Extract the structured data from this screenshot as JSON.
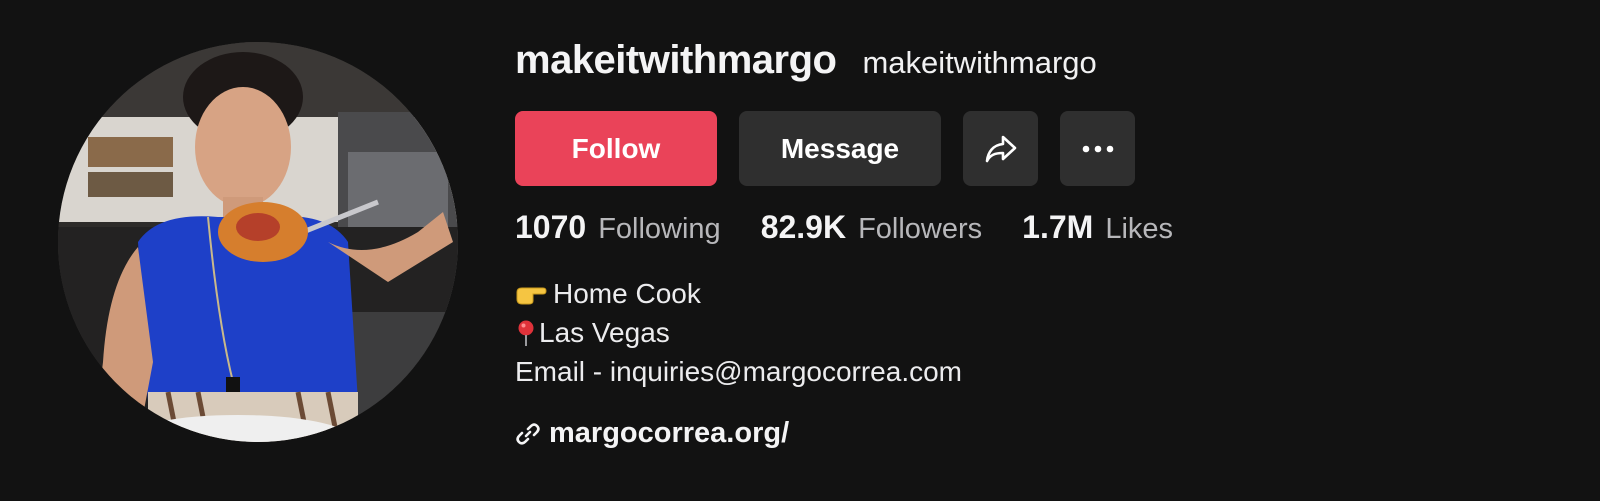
{
  "profile": {
    "username": "makeitwithmargo",
    "nickname": "makeitwithmargo"
  },
  "actions": {
    "follow_label": "Follow",
    "message_label": "Message",
    "share_icon": "share-arrow-icon",
    "more_icon": "more-dots-icon"
  },
  "stats": [
    {
      "value": "1070",
      "label": "Following"
    },
    {
      "value": "82.9K",
      "label": "Followers"
    },
    {
      "value": "1.7M",
      "label": "Likes"
    }
  ],
  "bio": {
    "line1": "Home Cook",
    "line2": "Las Vegas",
    "line3": "Email - inquiries@margocorrea.com"
  },
  "link": {
    "text": "margocorrea.org/",
    "icon": "link-chain-icon"
  },
  "colors": {
    "background": "#121212",
    "follow": "#ea4359",
    "button_dark": "#2f2f2f"
  }
}
